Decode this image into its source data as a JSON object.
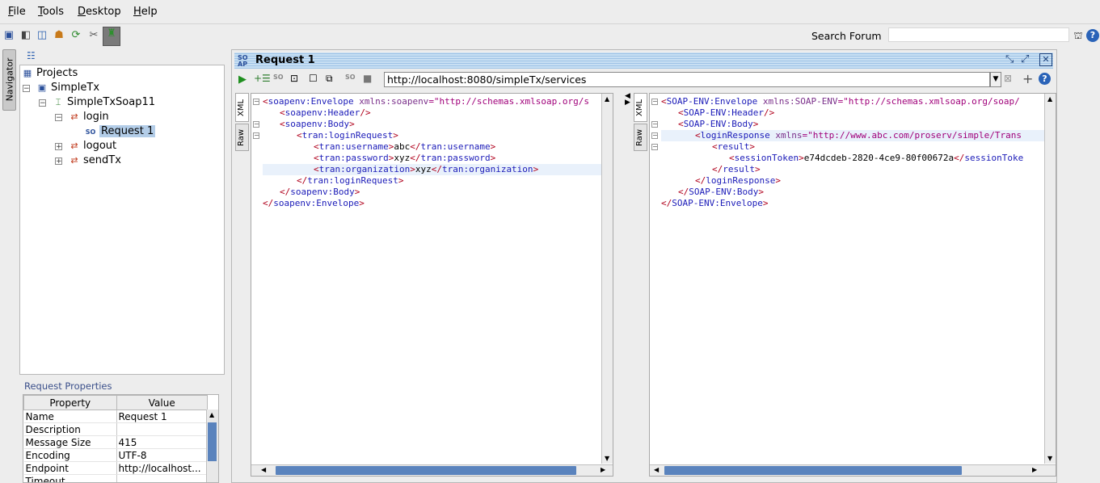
{
  "menu": [
    {
      "label": "File",
      "mnemonic": "F",
      "rest": "ile"
    },
    {
      "label": "Tools",
      "mnemonic": "T",
      "rest": "ools"
    },
    {
      "label": "Desktop",
      "mnemonic": "D",
      "rest": "esktop"
    },
    {
      "label": "Help",
      "mnemonic": "H",
      "rest": "elp"
    }
  ],
  "toolbar": {
    "icons": [
      "new-project-icon",
      "import-icon",
      "save-all-icon",
      "preferences-icon",
      "refresh-icon",
      "tools-icon",
      "monitor-icon"
    ],
    "search_label": "Search Forum",
    "search_value": ""
  },
  "navigator": {
    "tab_label": "Navigator"
  },
  "tree": {
    "root": "Projects",
    "project": "SimpleTx",
    "interface": "SimpleTxSoap11",
    "op_login": "login",
    "request": "Request 1",
    "op_logout": "logout",
    "op_sendtx": "sendTx"
  },
  "properties": {
    "title": "Request Properties",
    "columns": [
      "Property",
      "Value"
    ],
    "rows": [
      [
        "Name",
        "Request 1"
      ],
      [
        "Description",
        ""
      ],
      [
        "Message Size",
        "415"
      ],
      [
        "Encoding",
        "UTF-8"
      ],
      [
        "Endpoint",
        "http://localhost..."
      ],
      [
        "Timeout",
        ""
      ]
    ]
  },
  "request": {
    "title": "Request 1",
    "endpoint": "http://localhost:8080/simpleTx/services",
    "tabs": [
      "XML",
      "Raw"
    ]
  },
  "request_xml": [
    {
      "i": 0,
      "t": "<",
      "n": "soapenv:Envelope",
      "a": " xmlns:soapenv",
      "v": "=\"http://schemas.xmlsoap.org/s",
      "e": ""
    },
    {
      "i": 1,
      "t": "<",
      "n": "soapenv:Header",
      "a": "",
      "v": "",
      "e": "/>"
    },
    {
      "i": 1,
      "t": "<",
      "n": "soapenv:Body",
      "a": "",
      "v": "",
      "e": ">"
    },
    {
      "i": 2,
      "t": "<",
      "n": "tran:loginRequest",
      "a": "",
      "v": "",
      "e": ">"
    },
    {
      "i": 3,
      "raw": [
        [
          "tag",
          "<"
        ],
        [
          "nm",
          "tran:username"
        ],
        [
          "tag",
          ">"
        ],
        [
          "tx",
          "abc"
        ],
        [
          "tag",
          "</"
        ],
        [
          "nm",
          "tran:username"
        ],
        [
          "tag",
          ">"
        ]
      ]
    },
    {
      "i": 3,
      "raw": [
        [
          "tag",
          "<"
        ],
        [
          "nm",
          "tran:password"
        ],
        [
          "tag",
          ">"
        ],
        [
          "tx",
          "xyz"
        ],
        [
          "tag",
          "</"
        ],
        [
          "nm",
          "tran:password"
        ],
        [
          "tag",
          ">"
        ]
      ]
    },
    {
      "i": 3,
      "raw": [
        [
          "tag",
          "<"
        ],
        [
          "nm",
          "tran:organization"
        ],
        [
          "tag",
          ">"
        ],
        [
          "tx",
          "xyz"
        ],
        [
          "tag",
          "</"
        ],
        [
          "nm",
          "tran:organization"
        ],
        [
          "tag",
          ">"
        ]
      ]
    },
    {
      "i": 2,
      "t": "</",
      "n": "tran:loginRequest",
      "a": "",
      "v": "",
      "e": ">"
    },
    {
      "i": 1,
      "t": "</",
      "n": "soapenv:Body",
      "a": "",
      "v": "",
      "e": ">"
    },
    {
      "i": 0,
      "t": "</",
      "n": "soapenv:Envelope",
      "a": "",
      "v": "",
      "e": ">"
    }
  ],
  "response_xml": [
    {
      "i": 0,
      "t": "<",
      "n": "SOAP-ENV:Envelope",
      "a": " xmlns:SOAP-ENV",
      "v": "=\"http://schemas.xmlsoap.org/soap/",
      "e": ""
    },
    {
      "i": 1,
      "t": "<",
      "n": "SOAP-ENV:Header",
      "a": "",
      "v": "",
      "e": "/>"
    },
    {
      "i": 1,
      "t": "<",
      "n": "SOAP-ENV:Body",
      "a": "",
      "v": "",
      "e": ">"
    },
    {
      "i": 2,
      "t": "<",
      "n": "loginResponse",
      "a": " xmlns",
      "v": "=\"http://www.abc.com/proserv/simple/Trans",
      "e": ""
    },
    {
      "i": 3,
      "t": "<",
      "n": "result",
      "a": "",
      "v": "",
      "e": ">"
    },
    {
      "i": 4,
      "raw": [
        [
          "tag",
          "<"
        ],
        [
          "nm",
          "sessionToken"
        ],
        [
          "tag",
          ">"
        ],
        [
          "tx",
          "e74dcdeb-2820-4ce9-80f00672a"
        ],
        [
          "tag",
          "</"
        ],
        [
          "nm",
          "sessionToke"
        ]
      ]
    },
    {
      "i": 3,
      "t": "</",
      "n": "result",
      "a": "",
      "v": "",
      "e": ">"
    },
    {
      "i": 2,
      "t": "</",
      "n": "loginResponse",
      "a": "",
      "v": "",
      "e": ">"
    },
    {
      "i": 1,
      "t": "</",
      "n": "SOAP-ENV:Body",
      "a": "",
      "v": "",
      "e": ">"
    },
    {
      "i": 0,
      "t": "</",
      "n": "SOAP-ENV:Envelope",
      "a": "",
      "v": "",
      "e": ">"
    }
  ]
}
